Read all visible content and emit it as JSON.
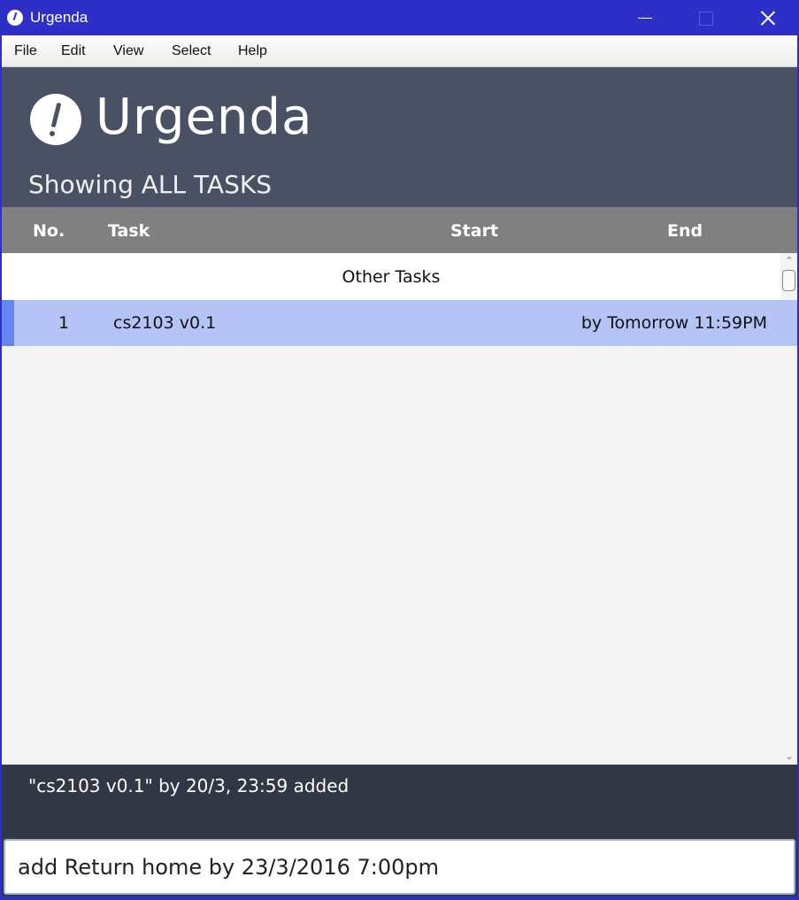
{
  "window": {
    "title": "Urgenda",
    "controls": {
      "minimize": "minimize",
      "maximize": "maximize",
      "close": "close"
    }
  },
  "menu": [
    "File",
    "Edit",
    "View",
    "Select",
    "Help"
  ],
  "header": {
    "app_name": "Urgenda",
    "showing": "Showing ALL TASKS"
  },
  "columns": {
    "no": "No.",
    "task": "Task",
    "start": "Start",
    "end": "End"
  },
  "sections": [
    {
      "label": "Other Tasks",
      "tasks": [
        {
          "no": "1",
          "task": "cs2103 v0.1",
          "start": "",
          "end": "by Tomorrow 11:59PM",
          "selected": true
        }
      ]
    }
  ],
  "feedback": "\"cs2103 v0.1\" by 20/3, 23:59 added",
  "command": {
    "value": "add Return home by 23/3/2016 7:00pm"
  },
  "colors": {
    "titlebar": "#2e2fc9",
    "header": "#4a5164",
    "column_header": "#808080",
    "selected_row": "#b4c4f6",
    "accent": "#6287f2",
    "feedback_bg": "#323745"
  }
}
